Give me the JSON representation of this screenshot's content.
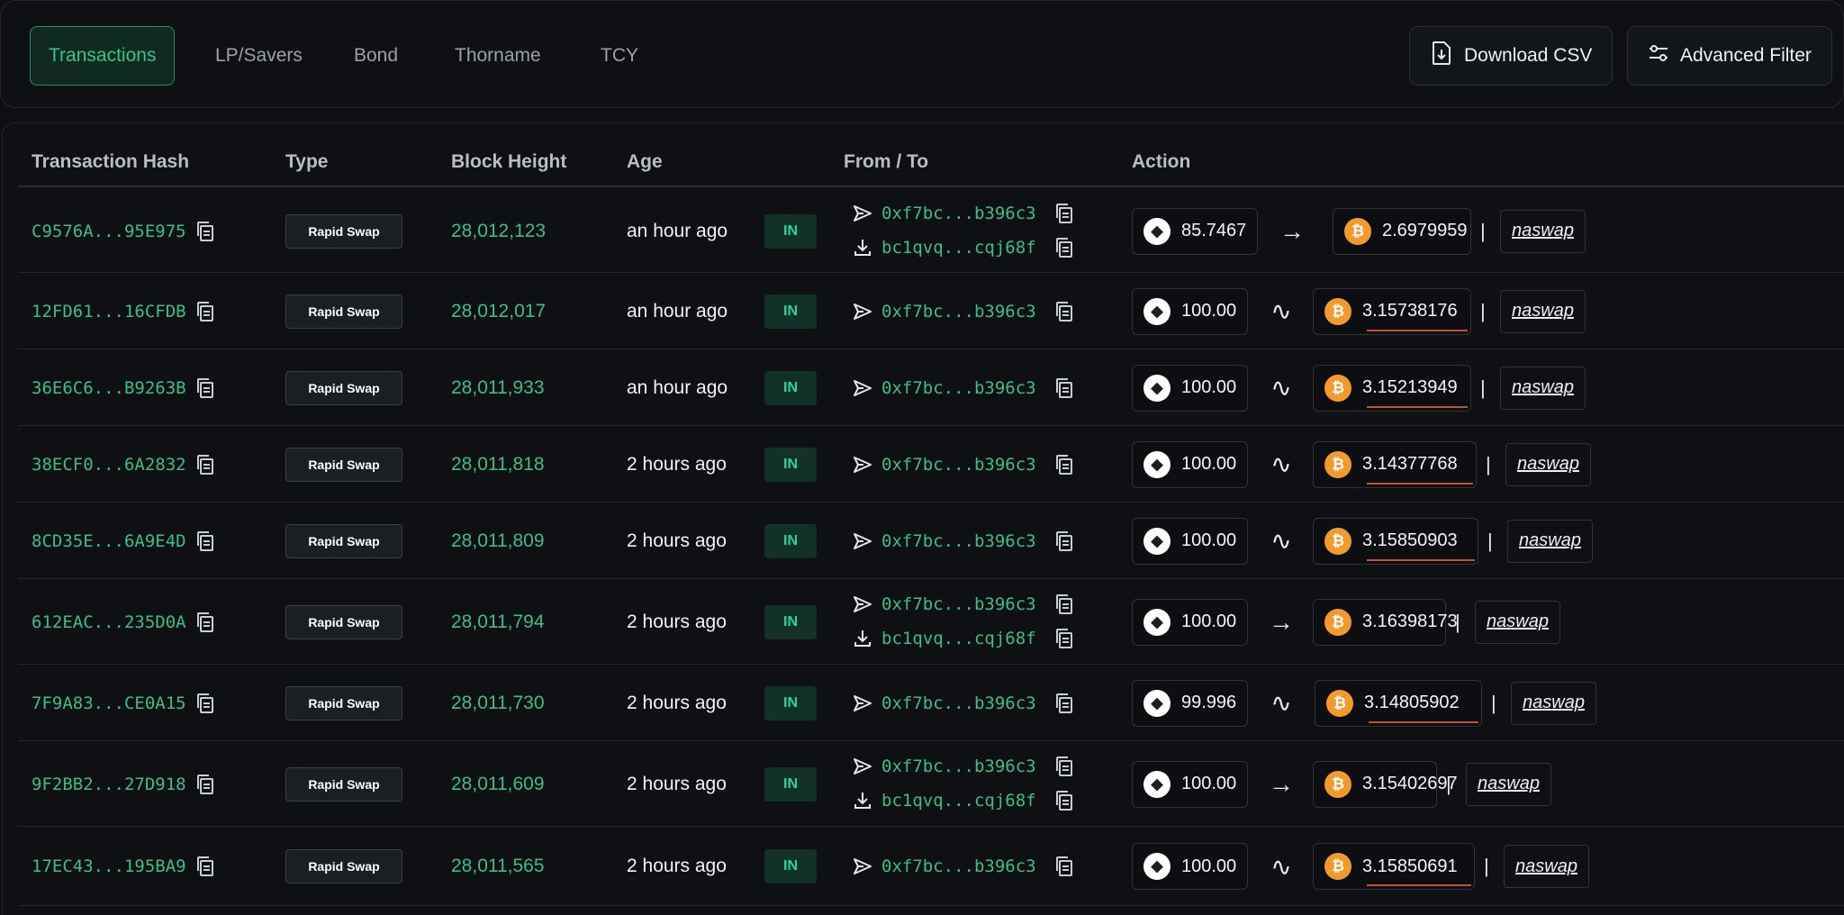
{
  "tabs": [
    {
      "label": "Transactions",
      "active": true
    },
    {
      "label": "LP/Savers",
      "active": false
    },
    {
      "label": "Bond",
      "active": false
    },
    {
      "label": "Thorname",
      "active": false
    },
    {
      "label": "TCY",
      "active": false
    }
  ],
  "toolbar": {
    "download_label": "Download CSV",
    "filter_label": "Advanced Filter"
  },
  "columns": {
    "hash": "Transaction Hash",
    "type": "Type",
    "block": "Block Height",
    "age": "Age",
    "fromto": "From / To",
    "action": "Action"
  },
  "colors": {
    "accent": "#3cbf85",
    "in_badge": "#2ad399",
    "btc": "#f39a2d"
  },
  "rows": [
    {
      "hash": "C9576A...95E975",
      "type": "Rapid Swap",
      "block": "28,012,123",
      "age": "an hour ago",
      "direction": "IN",
      "from": "0xf7bc...b396c3",
      "to": "bc1qvq...cqj68f",
      "in_amount": "85.7467",
      "in_asset_icon": "eth-icon",
      "arrow": "→",
      "out_amount": "2.6979959",
      "out_asset_icon": "btc-icon",
      "affiliate": "naswap"
    },
    {
      "hash": "12FD61...16CFDB",
      "type": "Rapid Swap",
      "block": "28,012,017",
      "age": "an hour ago",
      "direction": "IN",
      "from": "0xf7bc...b396c3",
      "to": "",
      "in_amount": "100.00",
      "in_asset_icon": "eth-icon",
      "arrow": "∿",
      "out_amount": "3.15738176",
      "out_asset_icon": "btc-icon",
      "affiliate": "naswap"
    },
    {
      "hash": "36E6C6...B9263B",
      "type": "Rapid Swap",
      "block": "28,011,933",
      "age": "an hour ago",
      "direction": "IN",
      "from": "0xf7bc...b396c3",
      "to": "",
      "in_amount": "100.00",
      "in_asset_icon": "eth-icon",
      "arrow": "∿",
      "out_amount": "3.15213949",
      "out_asset_icon": "btc-icon",
      "affiliate": "naswap"
    },
    {
      "hash": "38ECF0...6A2832",
      "type": "Rapid Swap",
      "block": "28,011,818",
      "age": "2 hours ago",
      "direction": "IN",
      "from": "0xf7bc...b396c3",
      "to": "",
      "in_amount": "100.00",
      "in_asset_icon": "eth-icon",
      "arrow": "∿",
      "out_amount": "3.14377768",
      "out_asset_icon": "btc-icon",
      "affiliate": "naswap"
    },
    {
      "hash": "8CD35E...6A9E4D",
      "type": "Rapid Swap",
      "block": "28,011,809",
      "age": "2 hours ago",
      "direction": "IN",
      "from": "0xf7bc...b396c3",
      "to": "",
      "in_amount": "100.00",
      "in_asset_icon": "eth-icon",
      "arrow": "∿",
      "out_amount": "3.15850903",
      "out_asset_icon": "btc-icon",
      "affiliate": "naswap"
    },
    {
      "hash": "612EAC...235D0A",
      "type": "Rapid Swap",
      "block": "28,011,794",
      "age": "2 hours ago",
      "direction": "IN",
      "from": "0xf7bc...b396c3",
      "to": "bc1qvq...cqj68f",
      "in_amount": "100.00",
      "in_asset_icon": "eth-icon",
      "arrow": "→",
      "out_amount": "3.16398173",
      "out_asset_icon": "btc-icon",
      "affiliate": "naswap"
    },
    {
      "hash": "7F9A83...CE0A15",
      "type": "Rapid Swap",
      "block": "28,011,730",
      "age": "2 hours ago",
      "direction": "IN",
      "from": "0xf7bc...b396c3",
      "to": "",
      "in_amount": "99.996",
      "in_asset_icon": "eth-icon",
      "arrow": "∿",
      "out_amount": "3.14805902",
      "out_asset_icon": "btc-icon",
      "affiliate": "naswap"
    },
    {
      "hash": "9F2BB2...27D918",
      "type": "Rapid Swap",
      "block": "28,011,609",
      "age": "2 hours ago",
      "direction": "IN",
      "from": "0xf7bc...b396c3",
      "to": "bc1qvq...cqj68f",
      "in_amount": "100.00",
      "in_asset_icon": "eth-icon",
      "arrow": "→",
      "out_amount": "3.15402697",
      "out_asset_icon": "btc-icon",
      "affiliate": "naswap"
    },
    {
      "hash": "17EC43...195BA9",
      "type": "Rapid Swap",
      "block": "28,011,565",
      "age": "2 hours ago",
      "direction": "IN",
      "from": "0xf7bc...b396c3",
      "to": "",
      "in_amount": "100.00",
      "in_asset_icon": "eth-icon",
      "arrow": "∿",
      "out_amount": "3.15850691",
      "out_asset_icon": "btc-icon",
      "affiliate": "naswap"
    }
  ]
}
